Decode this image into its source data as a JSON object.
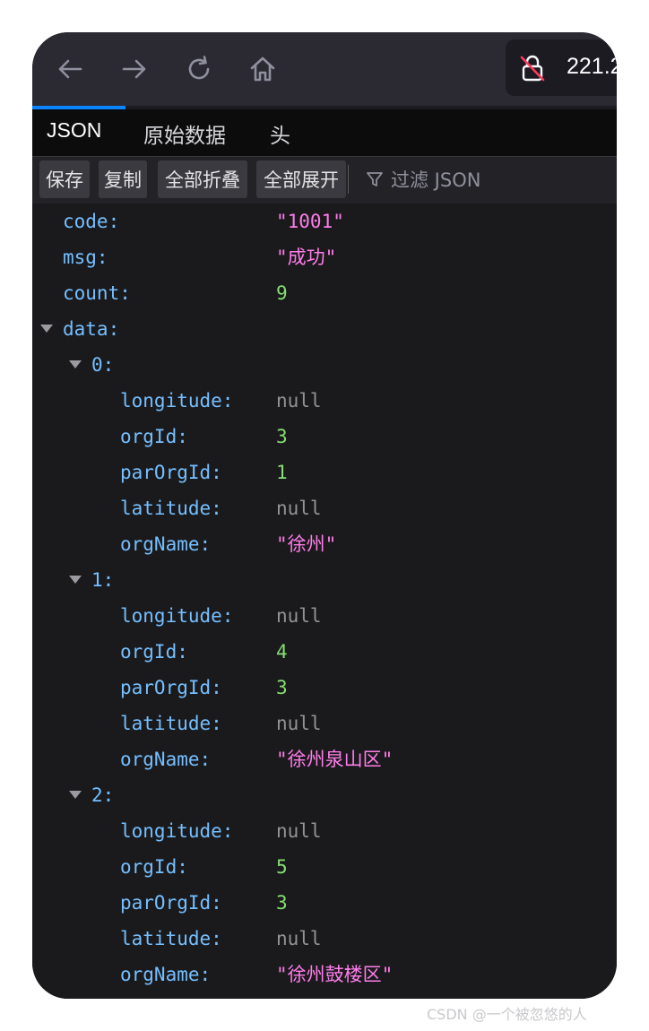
{
  "browser": {
    "url": "221.2"
  },
  "tabs": [
    {
      "label": "JSON"
    },
    {
      "label": "原始数据"
    },
    {
      "label": "头"
    }
  ],
  "actions": {
    "save": "保存",
    "copy": "复制",
    "collapse_all": "全部折叠",
    "expand_all": "全部展开",
    "filter_placeholder": "过滤 JSON"
  },
  "json": {
    "code": {
      "key": "code:",
      "value": "\"1001\""
    },
    "msg": {
      "key": "msg:",
      "value": "\"成功\""
    },
    "count": {
      "key": "count:",
      "value": "9"
    },
    "data_key": "data:",
    "items": [
      {
        "index": "0:",
        "longitude": {
          "key": "longitude:",
          "value": "null"
        },
        "orgId": {
          "key": "orgId:",
          "value": "3"
        },
        "parOrgId": {
          "key": "parOrgId:",
          "value": "1"
        },
        "latitude": {
          "key": "latitude:",
          "value": "null"
        },
        "orgName": {
          "key": "orgName:",
          "value": "\"徐州\""
        }
      },
      {
        "index": "1:",
        "longitude": {
          "key": "longitude:",
          "value": "null"
        },
        "orgId": {
          "key": "orgId:",
          "value": "4"
        },
        "parOrgId": {
          "key": "parOrgId:",
          "value": "3"
        },
        "latitude": {
          "key": "latitude:",
          "value": "null"
        },
        "orgName": {
          "key": "orgName:",
          "value": "\"徐州泉山区\""
        }
      },
      {
        "index": "2:",
        "longitude": {
          "key": "longitude:",
          "value": "null"
        },
        "orgId": {
          "key": "orgId:",
          "value": "5"
        },
        "parOrgId": {
          "key": "parOrgId:",
          "value": "3"
        },
        "latitude": {
          "key": "latitude:",
          "value": "null"
        },
        "orgName": {
          "key": "orgName:",
          "value": "\"徐州鼓楼区\""
        }
      }
    ]
  },
  "watermark": "CSDN @一个被忽悠的人"
}
